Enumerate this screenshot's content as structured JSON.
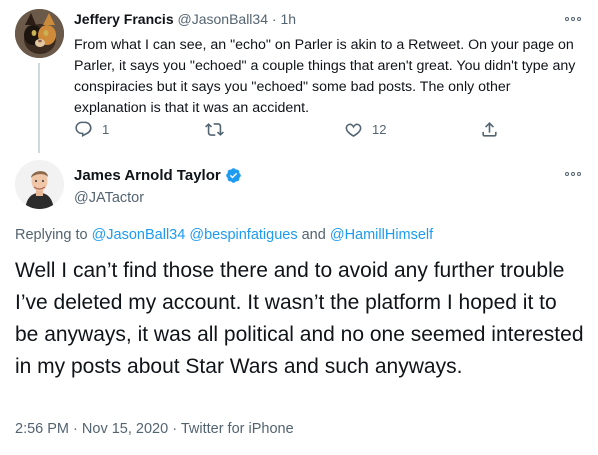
{
  "tweet1": {
    "author_name": "Jeffery Francis",
    "handle": "@JasonBall34",
    "separator": "·",
    "time": "1h",
    "text": "From what I can see, an \"echo\" on Parler is akin to a Retweet. On your page on Parler, it says you \"echoed\" a couple things that aren't great. You didn't type any conspiracies but it says you \"echoed\" some bad posts. The only other explanation is that it was an accident.",
    "reply_count": "1",
    "like_count": "12",
    "avatar_icon": "cat-avatar"
  },
  "tweet2": {
    "author_name": "James Arnold Taylor",
    "handle": "@JATactor",
    "verified": true,
    "replying_prefix": "Replying to",
    "reply_to_1": "@JasonBall34",
    "reply_to_2": "@bespinfatigues",
    "reply_and": "and",
    "reply_to_3": "@HamillHimself",
    "text": "Well I can’t find those there and to avoid any further trouble I’ve deleted my account. It wasn’t the platform I hoped it to be anyways, it was all political and no one seemed interested in my posts about Star Wars and such anyways.",
    "time": "2:56 PM",
    "dot": "·",
    "date": "Nov 15, 2020",
    "source": "Twitter for iPhone",
    "avatar_icon": "person-avatar"
  },
  "colors": {
    "link": "#1d9bf0",
    "muted": "#536471",
    "text": "#0f1419",
    "verified": "#1d9bf0"
  }
}
